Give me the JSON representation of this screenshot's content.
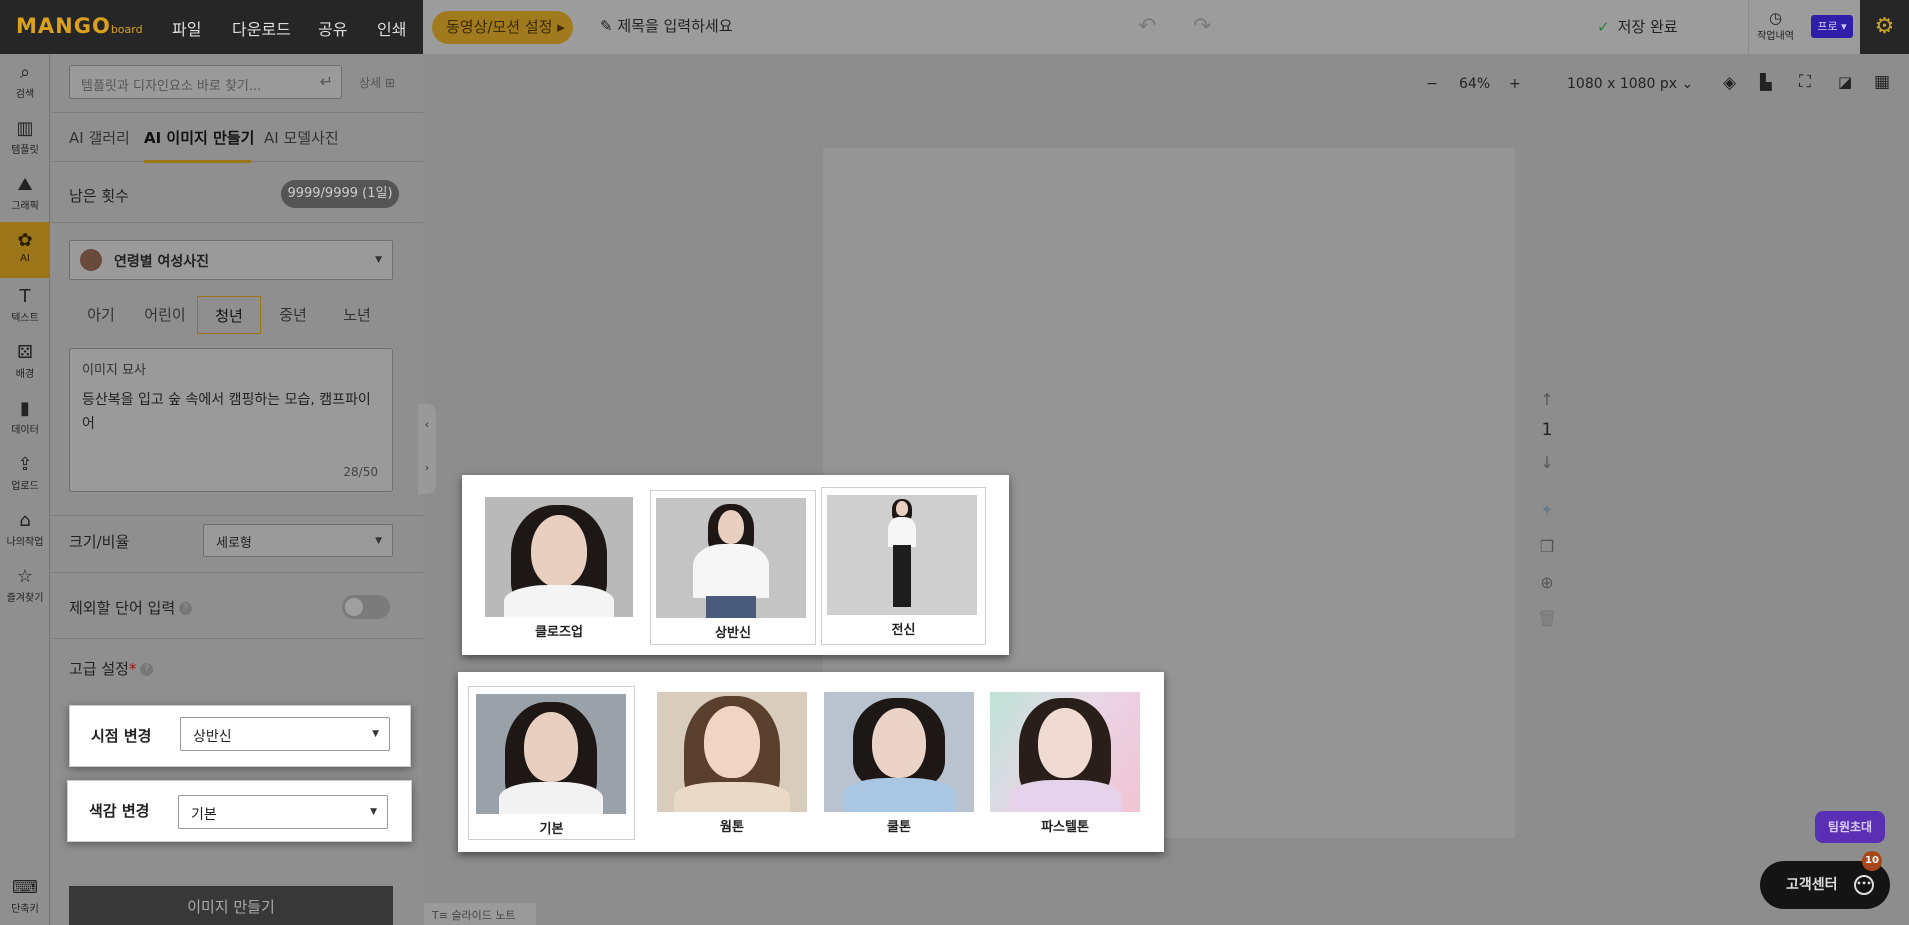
{
  "app": {
    "logo_main": "MANGO",
    "logo_sub": "board"
  },
  "topmenu": [
    "파일",
    "다운로드",
    "공유",
    "인쇄"
  ],
  "motion_button": "동영상/모션 설정 ▸",
  "title_placeholder": "제목을 입력하세요",
  "save_status": "저장 완료",
  "history_label": "작업내역",
  "pro_label": "프로",
  "iconbar": [
    {
      "label": "검색",
      "icon": "search-icon",
      "glyph": "⌕"
    },
    {
      "label": "템플릿",
      "icon": "template-icon",
      "glyph": "▥"
    },
    {
      "label": "그래픽",
      "icon": "graphic-icon",
      "glyph": "⛰"
    },
    {
      "label": "AI",
      "icon": "ai-icon",
      "glyph": "✿"
    },
    {
      "label": "텍스트",
      "icon": "text-icon",
      "glyph": "T"
    },
    {
      "label": "배경",
      "icon": "background-icon",
      "glyph": "⚄"
    },
    {
      "label": "데이터",
      "icon": "data-icon",
      "glyph": "▮"
    },
    {
      "label": "업로드",
      "icon": "upload-icon",
      "glyph": "⇪"
    },
    {
      "label": "나의작업",
      "icon": "my-work-icon",
      "glyph": "⌂"
    },
    {
      "label": "즐겨찾기",
      "icon": "star-icon",
      "glyph": "☆"
    }
  ],
  "shortcut_label": "단축키",
  "search": {
    "placeholder": "템플릿과 디자인요소 바로 찾기...",
    "detail": "상세"
  },
  "tabs": [
    "AI 갤러리",
    "AI 이미지 만들기",
    "AI 모델사진"
  ],
  "remaining": {
    "label": "남은 횟수",
    "value": "9999/9999 (1일)"
  },
  "model_select": "연령별 여성사진",
  "ages": [
    "아기",
    "어린이",
    "청년",
    "중년",
    "노년"
  ],
  "selected_age": "청년",
  "description": {
    "header": "이미지 묘사",
    "text": "등산복을 입고 숲 속에서 캠핑하는 모습, 캠프파이어",
    "count": "28/50"
  },
  "ratio": {
    "label": "크기/비율",
    "value": "세로형"
  },
  "exclude": {
    "label": "제외할 단어 입력"
  },
  "advanced": {
    "label": "고급 설정",
    "star": "*"
  },
  "viewpoint": {
    "label": "시점 변경",
    "value": "상반신"
  },
  "color_tone": {
    "label": "색감 변경",
    "value": "기본"
  },
  "make_button": "이미지 만들기",
  "zoom": {
    "minus": "−",
    "value": "64%",
    "plus": "+",
    "size": "1080 x 1080 px"
  },
  "page_number": "1",
  "slide_note": "슬라이드 노트",
  "viewpoint_options": [
    "클로즈업",
    "상반신",
    "전신"
  ],
  "tone_options": [
    "기본",
    "웜톤",
    "쿨톤",
    "파스텔톤"
  ],
  "team_invite": "팀원초대",
  "help_center": "고객센터",
  "help_badge": "10"
}
